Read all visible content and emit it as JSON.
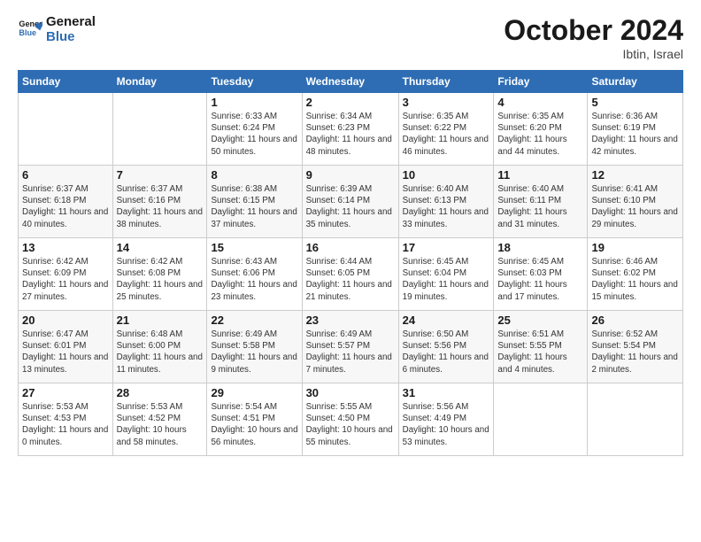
{
  "logo": {
    "line1": "General",
    "line2": "Blue"
  },
  "title": "October 2024",
  "subtitle": "Ibtin, Israel",
  "weekdays": [
    "Sunday",
    "Monday",
    "Tuesday",
    "Wednesday",
    "Thursday",
    "Friday",
    "Saturday"
  ],
  "weeks": [
    [
      {
        "day": "",
        "info": ""
      },
      {
        "day": "",
        "info": ""
      },
      {
        "day": "1",
        "info": "Sunrise: 6:33 AM\nSunset: 6:24 PM\nDaylight: 11 hours and 50 minutes."
      },
      {
        "day": "2",
        "info": "Sunrise: 6:34 AM\nSunset: 6:23 PM\nDaylight: 11 hours and 48 minutes."
      },
      {
        "day": "3",
        "info": "Sunrise: 6:35 AM\nSunset: 6:22 PM\nDaylight: 11 hours and 46 minutes."
      },
      {
        "day": "4",
        "info": "Sunrise: 6:35 AM\nSunset: 6:20 PM\nDaylight: 11 hours and 44 minutes."
      },
      {
        "day": "5",
        "info": "Sunrise: 6:36 AM\nSunset: 6:19 PM\nDaylight: 11 hours and 42 minutes."
      }
    ],
    [
      {
        "day": "6",
        "info": "Sunrise: 6:37 AM\nSunset: 6:18 PM\nDaylight: 11 hours and 40 minutes."
      },
      {
        "day": "7",
        "info": "Sunrise: 6:37 AM\nSunset: 6:16 PM\nDaylight: 11 hours and 38 minutes."
      },
      {
        "day": "8",
        "info": "Sunrise: 6:38 AM\nSunset: 6:15 PM\nDaylight: 11 hours and 37 minutes."
      },
      {
        "day": "9",
        "info": "Sunrise: 6:39 AM\nSunset: 6:14 PM\nDaylight: 11 hours and 35 minutes."
      },
      {
        "day": "10",
        "info": "Sunrise: 6:40 AM\nSunset: 6:13 PM\nDaylight: 11 hours and 33 minutes."
      },
      {
        "day": "11",
        "info": "Sunrise: 6:40 AM\nSunset: 6:11 PM\nDaylight: 11 hours and 31 minutes."
      },
      {
        "day": "12",
        "info": "Sunrise: 6:41 AM\nSunset: 6:10 PM\nDaylight: 11 hours and 29 minutes."
      }
    ],
    [
      {
        "day": "13",
        "info": "Sunrise: 6:42 AM\nSunset: 6:09 PM\nDaylight: 11 hours and 27 minutes."
      },
      {
        "day": "14",
        "info": "Sunrise: 6:42 AM\nSunset: 6:08 PM\nDaylight: 11 hours and 25 minutes."
      },
      {
        "day": "15",
        "info": "Sunrise: 6:43 AM\nSunset: 6:06 PM\nDaylight: 11 hours and 23 minutes."
      },
      {
        "day": "16",
        "info": "Sunrise: 6:44 AM\nSunset: 6:05 PM\nDaylight: 11 hours and 21 minutes."
      },
      {
        "day": "17",
        "info": "Sunrise: 6:45 AM\nSunset: 6:04 PM\nDaylight: 11 hours and 19 minutes."
      },
      {
        "day": "18",
        "info": "Sunrise: 6:45 AM\nSunset: 6:03 PM\nDaylight: 11 hours and 17 minutes."
      },
      {
        "day": "19",
        "info": "Sunrise: 6:46 AM\nSunset: 6:02 PM\nDaylight: 11 hours and 15 minutes."
      }
    ],
    [
      {
        "day": "20",
        "info": "Sunrise: 6:47 AM\nSunset: 6:01 PM\nDaylight: 11 hours and 13 minutes."
      },
      {
        "day": "21",
        "info": "Sunrise: 6:48 AM\nSunset: 6:00 PM\nDaylight: 11 hours and 11 minutes."
      },
      {
        "day": "22",
        "info": "Sunrise: 6:49 AM\nSunset: 5:58 PM\nDaylight: 11 hours and 9 minutes."
      },
      {
        "day": "23",
        "info": "Sunrise: 6:49 AM\nSunset: 5:57 PM\nDaylight: 11 hours and 7 minutes."
      },
      {
        "day": "24",
        "info": "Sunrise: 6:50 AM\nSunset: 5:56 PM\nDaylight: 11 hours and 6 minutes."
      },
      {
        "day": "25",
        "info": "Sunrise: 6:51 AM\nSunset: 5:55 PM\nDaylight: 11 hours and 4 minutes."
      },
      {
        "day": "26",
        "info": "Sunrise: 6:52 AM\nSunset: 5:54 PM\nDaylight: 11 hours and 2 minutes."
      }
    ],
    [
      {
        "day": "27",
        "info": "Sunrise: 5:53 AM\nSunset: 4:53 PM\nDaylight: 11 hours and 0 minutes."
      },
      {
        "day": "28",
        "info": "Sunrise: 5:53 AM\nSunset: 4:52 PM\nDaylight: 10 hours and 58 minutes."
      },
      {
        "day": "29",
        "info": "Sunrise: 5:54 AM\nSunset: 4:51 PM\nDaylight: 10 hours and 56 minutes."
      },
      {
        "day": "30",
        "info": "Sunrise: 5:55 AM\nSunset: 4:50 PM\nDaylight: 10 hours and 55 minutes."
      },
      {
        "day": "31",
        "info": "Sunrise: 5:56 AM\nSunset: 4:49 PM\nDaylight: 10 hours and 53 minutes."
      },
      {
        "day": "",
        "info": ""
      },
      {
        "day": "",
        "info": ""
      }
    ]
  ]
}
